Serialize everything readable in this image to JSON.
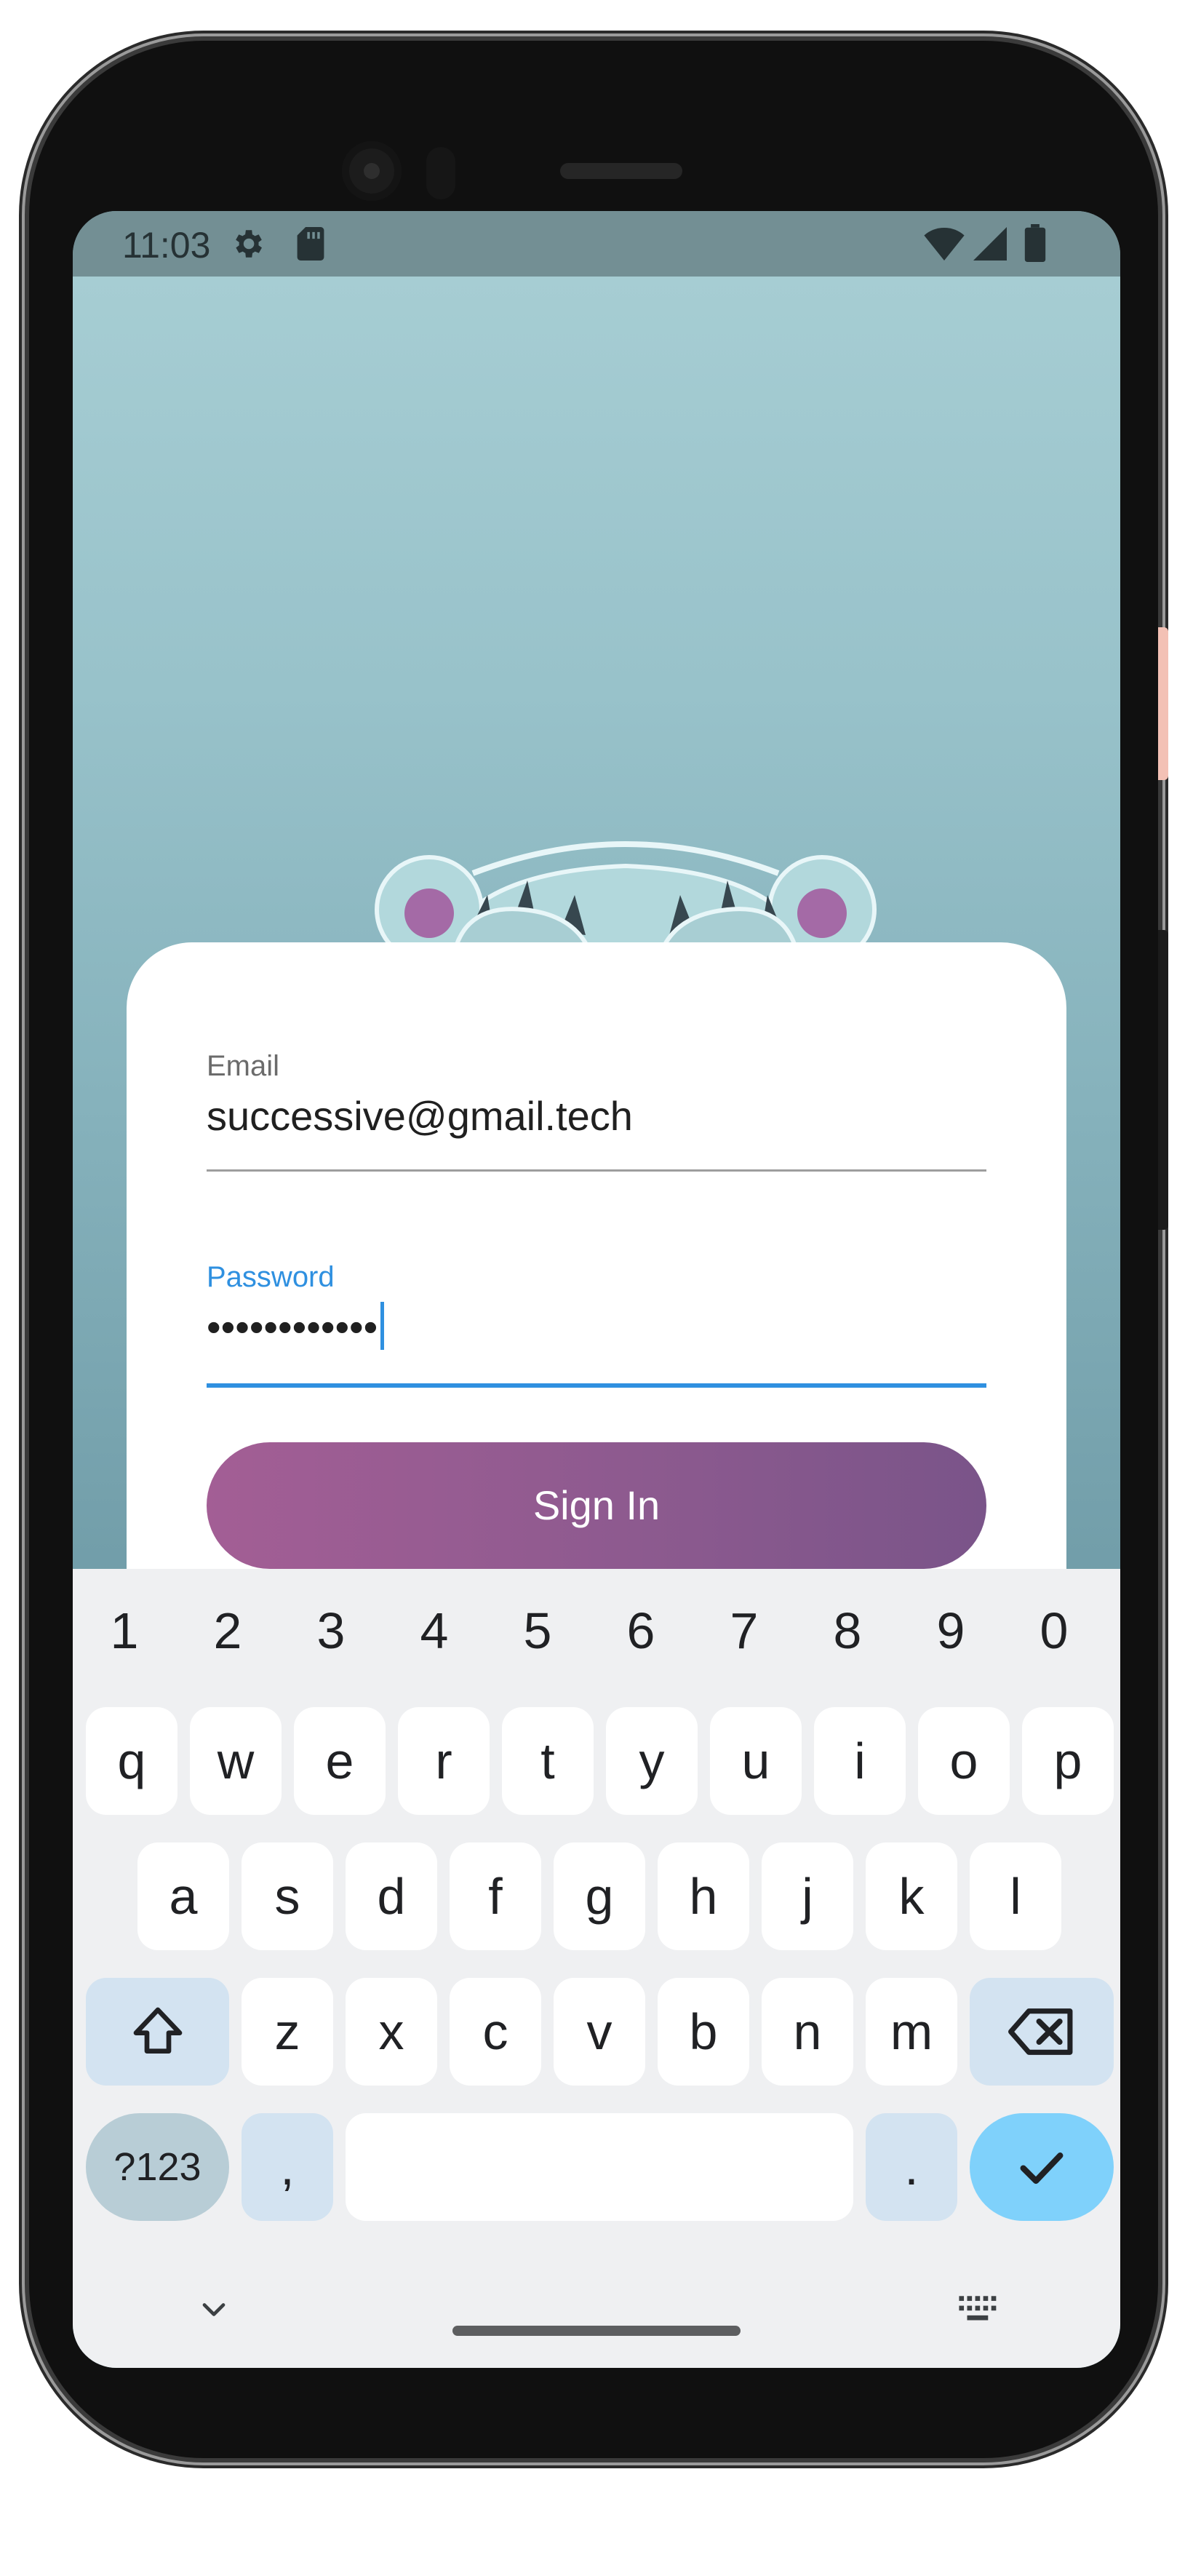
{
  "statusbar": {
    "time": "11:03",
    "icons": [
      "gear-icon",
      "sd-card-icon",
      "wifi-icon",
      "cell-signal-icon",
      "battery-icon"
    ]
  },
  "form": {
    "email_label": "Email",
    "email_value": "successive@gmail.tech",
    "password_label": "Password",
    "password_value": "••••••••••••",
    "signin_label": "Sign In"
  },
  "keyboard": {
    "number_row": [
      "1",
      "2",
      "3",
      "4",
      "5",
      "6",
      "7",
      "8",
      "9",
      "0"
    ],
    "row1": [
      "q",
      "w",
      "e",
      "r",
      "t",
      "y",
      "u",
      "i",
      "o",
      "p"
    ],
    "row2": [
      "a",
      "s",
      "d",
      "f",
      "g",
      "h",
      "j",
      "k",
      "l"
    ],
    "row3": [
      "z",
      "x",
      "c",
      "v",
      "b",
      "n",
      "m"
    ],
    "symbols_label": "?123",
    "comma_label": ",",
    "period_label": ".",
    "icons": [
      "shift-icon",
      "backspace-icon",
      "checkmark-icon",
      "chevron-down-icon",
      "keyboard-icon"
    ]
  },
  "colors": {
    "accent_blue": "#2f90e0",
    "button_gradient_start": "#a35e95",
    "button_gradient_end": "#7a5489",
    "enter_key": "#7fd1fb",
    "hero_bg": "#98c2ca"
  }
}
